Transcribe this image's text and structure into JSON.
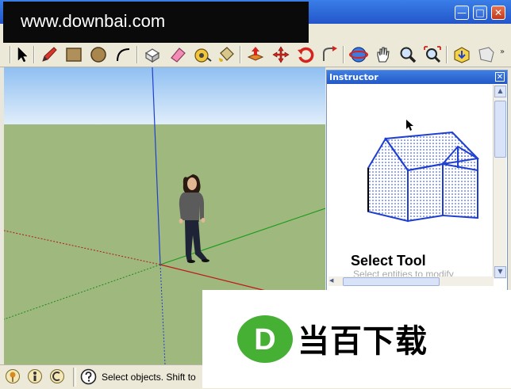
{
  "watermark": {
    "text": "www.downbai.com"
  },
  "toolbar": {
    "tools": [
      "select-tool",
      "pencil-tool",
      "rectangle-tool",
      "circle-tool",
      "arc-tool",
      "eraser-tool",
      "paint-bucket-tool",
      "tape-measure-tool",
      "paint-tool",
      "push-pull-tool",
      "move-tool",
      "rotate-tool",
      "follow-me-tool",
      "orbit-tool",
      "pan-tool",
      "zoom-tool",
      "zoom-extents-tool",
      "get-models-tool",
      "share-model-tool"
    ]
  },
  "instructor": {
    "title": "Instructor",
    "close_label": "✕",
    "heading": "Select Tool",
    "subtitle": "Select entities to modify"
  },
  "status": {
    "text": "Select objects. Shift to"
  },
  "logo": {
    "letter": "D",
    "text": "当百下载"
  },
  "colors": {
    "sky": "#a9cff6",
    "ground": "#9fb87e",
    "axis_blue": "#1f3fd0",
    "axis_green": "#1a9a1a",
    "axis_red": "#c01818",
    "logo_green": "#46b035"
  }
}
